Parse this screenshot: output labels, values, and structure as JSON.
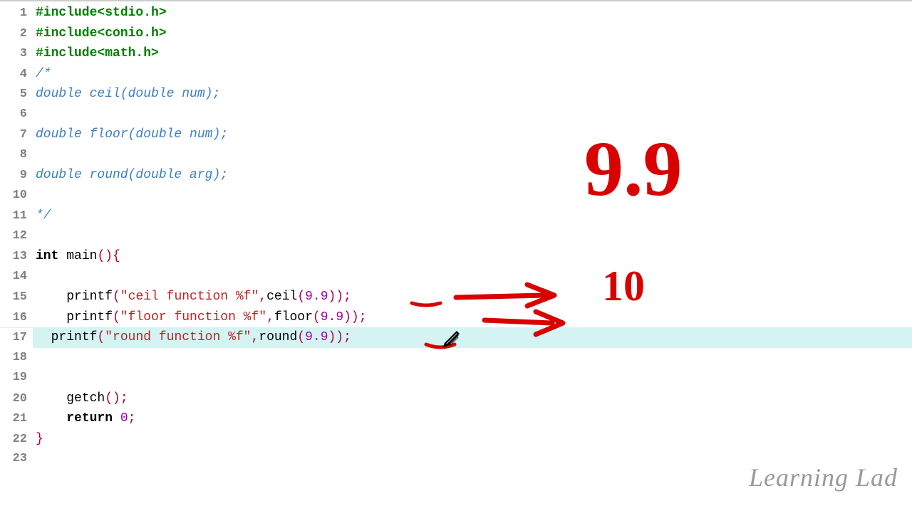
{
  "watermark_text": "Learning Lad",
  "annotations": {
    "big_number": "9.9",
    "small_number": "10"
  },
  "code_lines": [
    {
      "n": 1,
      "tokens": [
        {
          "c": "pp",
          "t": "#include<stdio.h>"
        }
      ]
    },
    {
      "n": 2,
      "tokens": [
        {
          "c": "pp",
          "t": "#include<conio.h>"
        }
      ]
    },
    {
      "n": 3,
      "tokens": [
        {
          "c": "pp",
          "t": "#include<math.h>"
        }
      ]
    },
    {
      "n": 4,
      "tokens": [
        {
          "c": "cmt",
          "t": "/*"
        }
      ]
    },
    {
      "n": 5,
      "tokens": [
        {
          "c": "cmt",
          "t": "double ceil(double num);"
        }
      ]
    },
    {
      "n": 6,
      "tokens": []
    },
    {
      "n": 7,
      "tokens": [
        {
          "c": "cmt",
          "t": "double floor(double num);"
        }
      ]
    },
    {
      "n": 8,
      "tokens": []
    },
    {
      "n": 9,
      "tokens": [
        {
          "c": "cmt",
          "t": "double round(double arg);"
        }
      ]
    },
    {
      "n": 10,
      "tokens": []
    },
    {
      "n": 11,
      "tokens": [
        {
          "c": "cmt",
          "t": "*/"
        }
      ]
    },
    {
      "n": 12,
      "tokens": []
    },
    {
      "n": 13,
      "tokens": [
        {
          "c": "kw",
          "t": "int "
        },
        {
          "c": "id",
          "t": "main"
        },
        {
          "c": "op",
          "t": "()"
        },
        {
          "c": "op",
          "t": "{"
        }
      ]
    },
    {
      "n": 14,
      "tokens": []
    },
    {
      "n": 15,
      "tokens": [
        {
          "c": "id",
          "t": "    printf"
        },
        {
          "c": "op",
          "t": "("
        },
        {
          "c": "str",
          "t": "\"ceil function %f\""
        },
        {
          "c": "op",
          "t": ","
        },
        {
          "c": "id",
          "t": "ceil"
        },
        {
          "c": "op",
          "t": "("
        },
        {
          "c": "num",
          "t": "9.9"
        },
        {
          "c": "op",
          "t": "))"
        },
        {
          "c": "op",
          "t": ";"
        }
      ]
    },
    {
      "n": 16,
      "tokens": [
        {
          "c": "id",
          "t": "    printf"
        },
        {
          "c": "op",
          "t": "("
        },
        {
          "c": "str",
          "t": "\"floor function %f\""
        },
        {
          "c": "op",
          "t": ","
        },
        {
          "c": "id",
          "t": "floor"
        },
        {
          "c": "op",
          "t": "("
        },
        {
          "c": "num",
          "t": "9.9"
        },
        {
          "c": "op",
          "t": "))"
        },
        {
          "c": "op",
          "t": ";"
        }
      ]
    },
    {
      "n": 17,
      "hl": true,
      "tokens": [
        {
          "c": "id",
          "t": "  printf"
        },
        {
          "c": "op",
          "t": "("
        },
        {
          "c": "str",
          "t": "\"round function %f\""
        },
        {
          "c": "op",
          "t": ","
        },
        {
          "c": "id",
          "t": "round"
        },
        {
          "c": "op",
          "t": "("
        },
        {
          "c": "num",
          "t": "9.9"
        },
        {
          "c": "op",
          "t": "))"
        },
        {
          "c": "op",
          "t": ";"
        }
      ]
    },
    {
      "n": 18,
      "tokens": []
    },
    {
      "n": 19,
      "tokens": []
    },
    {
      "n": 20,
      "tokens": [
        {
          "c": "id",
          "t": "    getch"
        },
        {
          "c": "op",
          "t": "();"
        }
      ]
    },
    {
      "n": 21,
      "tokens": [
        {
          "c": "id",
          "t": "    "
        },
        {
          "c": "kw",
          "t": "return "
        },
        {
          "c": "num",
          "t": "0"
        },
        {
          "c": "op",
          "t": ";"
        }
      ]
    },
    {
      "n": 22,
      "tokens": [
        {
          "c": "op",
          "t": "}"
        }
      ]
    },
    {
      "n": 23,
      "tokens": []
    }
  ]
}
